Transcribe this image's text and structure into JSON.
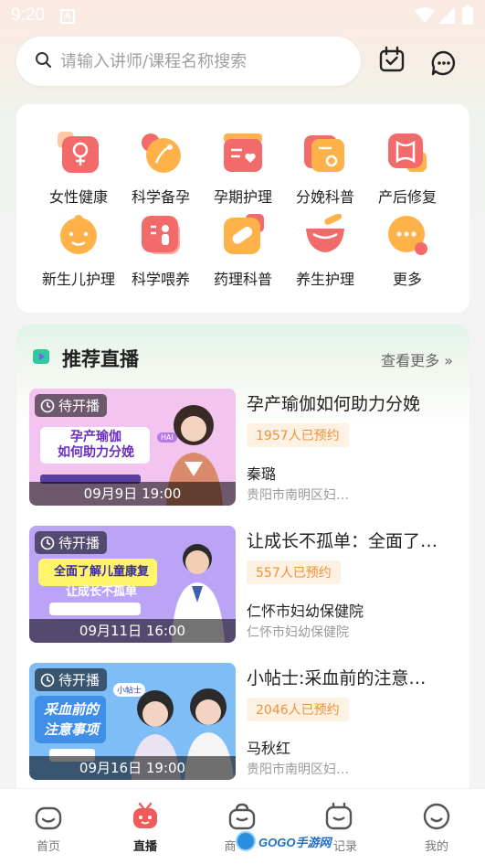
{
  "status_bar": {
    "time": "9:20",
    "a_label": "A"
  },
  "search": {
    "placeholder": "请输入讲师/课程名称搜索"
  },
  "categories": [
    {
      "label": "女性健康",
      "icon": "female-icon"
    },
    {
      "label": "科学备孕",
      "icon": "pregnancy-prep-icon"
    },
    {
      "label": "孕期护理",
      "icon": "pregnancy-care-icon"
    },
    {
      "label": "分娩科普",
      "icon": "childbirth-icon"
    },
    {
      "label": "产后修复",
      "icon": "postpartum-icon"
    },
    {
      "label": "新生儿护理",
      "icon": "newborn-icon"
    },
    {
      "label": "科学喂养",
      "icon": "feeding-icon"
    },
    {
      "label": "药理科普",
      "icon": "pill-icon"
    },
    {
      "label": "养生护理",
      "icon": "wellness-bowl-icon"
    },
    {
      "label": "更多",
      "icon": "more-icon"
    }
  ],
  "live": {
    "title": "推荐直播",
    "more_label": "查看更多",
    "cards": [
      {
        "badge": "待开播",
        "time": "09月9日 19:00",
        "title": "孕产瑜伽如何助力分娩",
        "count": "1957人已预约",
        "teacher": "秦璐",
        "org": "贵阳市南明区妇…",
        "thumb_line1": "孕产瑜伽",
        "thumb_line2": "如何助力分娩",
        "thumb_tag": "HAI"
      },
      {
        "badge": "待开播",
        "time": "09月11日 16:00",
        "title": "让成长不孤单：全面了…",
        "count": "557人已预约",
        "teacher": "仁怀市妇幼保健院",
        "org": "仁怀市妇幼保健院",
        "thumb_line1": "全面了解儿童康复",
        "thumb_line2": "让成长不孤单"
      },
      {
        "badge": "待开播",
        "time": "09月16日 19:00",
        "title": "小帖士:采血前的注意…",
        "count": "2046人已预约",
        "teacher": "马秋红",
        "org": "贵阳市南明区妇…",
        "thumb_line1": "采血前的",
        "thumb_line2": "注意事项",
        "thumb_tag": "小帖士"
      }
    ]
  },
  "nav": [
    {
      "label": "首页",
      "icon": "home-icon"
    },
    {
      "label": "直播",
      "icon": "live-tv-icon",
      "active": true
    },
    {
      "label": "商",
      "icon": "shop-bag-icon"
    },
    {
      "label": "记录",
      "icon": "record-calendar-icon"
    },
    {
      "label": "我的",
      "icon": "profile-smile-icon"
    }
  ],
  "watermark": {
    "text": "GOGO手游网"
  },
  "colors": {
    "accent": "#f15a5a",
    "orange": "#f0923a",
    "count_bg": "#fdf1e3",
    "live_green": "#2ec9a0"
  }
}
